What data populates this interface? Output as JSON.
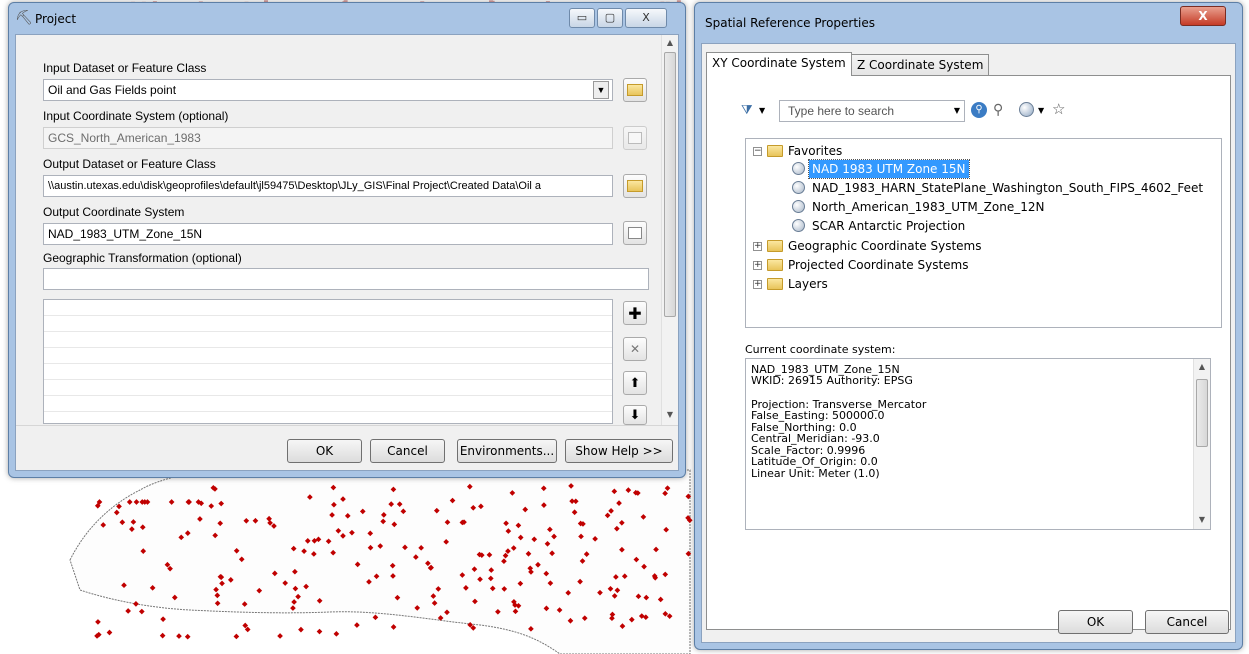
{
  "project_window": {
    "title": "Project",
    "caption_buttons": {
      "minimize": "▭",
      "maximize": "▢",
      "close": "X"
    },
    "input_dataset_label": "Input Dataset or Feature Class",
    "input_dataset_value": "Oil and Gas Fields point",
    "input_cs_label": "Input Coordinate System (optional)",
    "input_cs_value": "GCS_North_American_1983",
    "output_dataset_label": "Output Dataset or Feature Class",
    "output_dataset_value": "\\\\austin.utexas.edu\\disk\\geoprofiles\\default\\jl59475\\Desktop\\JLy_GIS\\Final Project\\Created Data\\Oil a",
    "output_cs_label": "Output Coordinate System",
    "output_cs_value": "NAD_1983_UTM_Zone_15N",
    "geo_transform_label": "Geographic Transformation (optional)",
    "geo_transform_value": "",
    "buttons": {
      "ok": "OK",
      "cancel": "Cancel",
      "environments": "Environments...",
      "show_help": "Show Help >>"
    }
  },
  "spatial_window": {
    "title": "Spatial Reference Properties",
    "close_label": "X",
    "tabs": [
      {
        "label": "XY Coordinate System"
      },
      {
        "label": "Z Coordinate System"
      }
    ],
    "search": {
      "placeholder": "Type here to search"
    },
    "tree": {
      "favorites": {
        "label": "Favorites",
        "expander": "−",
        "items": [
          "NAD 1983 UTM Zone 15N",
          "NAD_1983_HARN_StatePlane_Washington_South_FIPS_4602_Feet",
          "North_American_1983_UTM_Zone_12N",
          "SCAR Antarctic Projection"
        ]
      },
      "folders": [
        {
          "label": "Geographic Coordinate Systems",
          "expander": "+"
        },
        {
          "label": "Projected Coordinate Systems",
          "expander": "+"
        },
        {
          "label": "Layers",
          "expander": "+"
        }
      ]
    },
    "current_cs_label": "Current coordinate system:",
    "current_cs_lines": [
      "NAD_1983_UTM_Zone_15N",
      "WKID: 26915 Authority: EPSG",
      "",
      "Projection: Transverse_Mercator",
      "False_Easting: 500000.0",
      "False_Northing: 0.0",
      "Central_Meridian: -93.0",
      "Scale_Factor: 0.9996",
      "Latitude_Of_Origin: 0.0",
      "Linear Unit: Meter (1.0)"
    ],
    "buttons": {
      "ok": "OK",
      "cancel": "Cancel"
    }
  },
  "colors": {
    "selection": "#3399ff",
    "point": "#c00000",
    "window_frame": "#a9c4e4",
    "close_red": "#c94a3a"
  }
}
